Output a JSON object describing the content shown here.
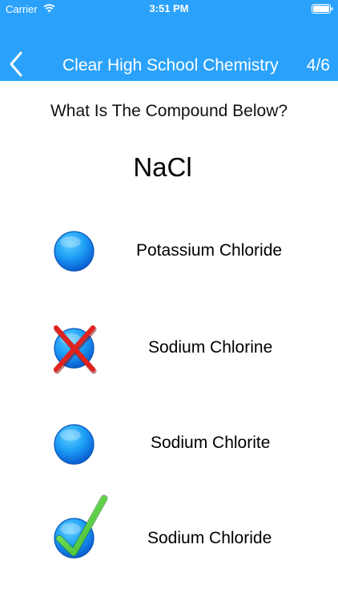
{
  "status_bar": {
    "carrier": "Carrier",
    "time": "3:51 PM"
  },
  "nav": {
    "title": "Clear High School Chemistry",
    "counter": "4/6"
  },
  "quiz": {
    "question": "What Is The Compound Below?",
    "compound": "NaCl",
    "options": [
      {
        "label": "Potassium Chloride",
        "state": "unselected"
      },
      {
        "label": "Sodium Chlorine",
        "state": "wrong"
      },
      {
        "label": "Sodium Chlorite",
        "state": "unselected"
      },
      {
        "label": "Sodium Chloride",
        "state": "correct"
      }
    ]
  },
  "colors": {
    "header_bg": "#2aa2fb",
    "wrong_mark": "#e0231e",
    "correct_mark": "#4cd137"
  },
  "icons": {
    "back": "chevron-left-icon",
    "wifi": "wifi-icon",
    "battery": "battery-icon",
    "wrong": "cross-icon",
    "correct": "checkmark-icon"
  }
}
